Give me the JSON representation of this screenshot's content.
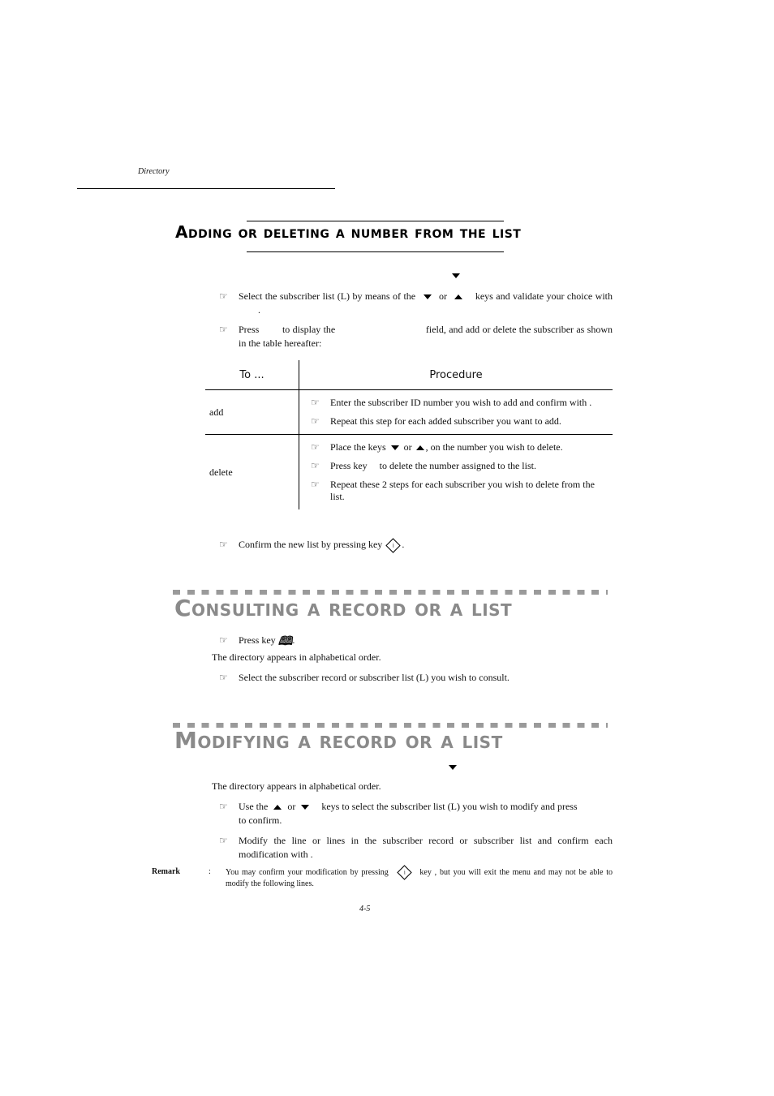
{
  "header": {
    "section_label": "Directory"
  },
  "sections": {
    "adding": {
      "title": "Adding or deleting a number from the list",
      "steps": [
        {
          "before": "Select the subscriber list (L) by means of the",
          "mid": "or",
          "after": "keys and validate your choice with",
          "end": "."
        },
        {
          "before": "Press",
          "mid": "to display the",
          "after": "field, and add or delete the subscriber as shown in the table hereafter:"
        }
      ],
      "table": {
        "headers": [
          "To ...",
          "Procedure"
        ],
        "rows": [
          {
            "action": "add",
            "steps": [
              "Enter the subscriber ID number you wish to add and confirm with .",
              "Repeat this step for each added subscriber you want to add."
            ]
          },
          {
            "action": "delete",
            "steps": [
              {
                "before": "Place the keys",
                "mid": "or",
                "after": ", on the number you wish to delete."
              },
              "Press key     to delete the number assigned to the list.",
              "Repeat these 2 steps for each subscriber you wish to delete from the list."
            ]
          }
        ]
      },
      "confirm_step": {
        "text": "Confirm the new list by pressing key",
        "end": "."
      }
    },
    "consulting": {
      "title": "Consulting a record or a list",
      "step1": {
        "text": "Press key",
        "end": "."
      },
      "note": "The directory appears in alphabetical order.",
      "step2": "Select the subscriber record or subscriber list (L) you wish to consult."
    },
    "modifying": {
      "title": "Modifying a record or a list",
      "note": "The directory appears in alphabetical order.",
      "step1": {
        "before": "Use the",
        "mid": "or",
        "after": "keys to select the subscriber list (L) you wish to modify and press",
        "line2": "to confirm."
      },
      "step2": "Modify the line or lines in the subscriber record or subscriber list and confirm each modification with     .",
      "remark": {
        "label": "Remark",
        "colon": ":",
        "before": "You may confirm your modification by pressing",
        "after": "key , but you will exit the menu and may not be able to modify the following lines."
      }
    }
  },
  "icons": {
    "bullet": "☞",
    "ok_key_glyph": "i",
    "book_glyph": "🕮"
  },
  "footer": {
    "page_number": "4-5"
  },
  "colors": {
    "section_title_gray": "#8a8a8a",
    "dash_gray": "#9a9a9a"
  }
}
